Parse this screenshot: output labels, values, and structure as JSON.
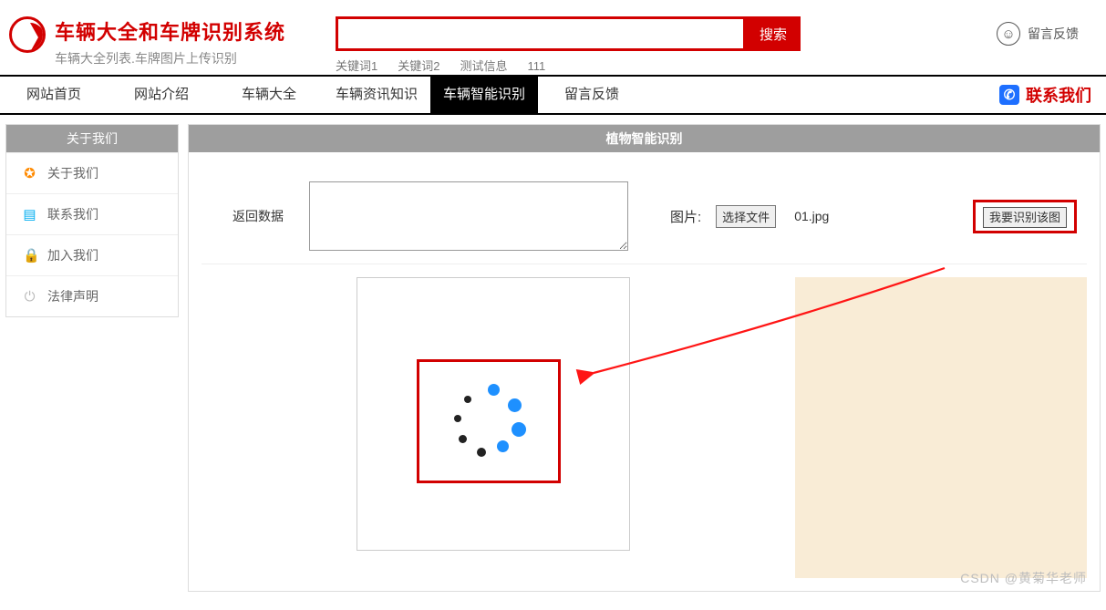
{
  "header": {
    "title": "车辆大全和车牌识别系统",
    "subtitle": "车辆大全列表.车牌图片上传识别",
    "search_button": "搜索",
    "keywords": [
      "关键词1",
      "关键词2",
      "测试信息",
      "111"
    ],
    "feedback_label": "留言反馈"
  },
  "nav": {
    "items": [
      "网站首页",
      "网站介绍",
      "车辆大全",
      "车辆资讯知识",
      "车辆智能识别",
      "留言反馈"
    ],
    "active_index": 4,
    "contact": "联系我们"
  },
  "sidebar": {
    "title": "关于我们",
    "items": [
      {
        "icon": "info-icon",
        "cls": "ic-orange",
        "glyph": "✪",
        "label": "关于我们"
      },
      {
        "icon": "card-icon",
        "cls": "ic-blue",
        "glyph": "▤",
        "label": "联系我们"
      },
      {
        "icon": "lock-icon",
        "cls": "ic-red",
        "glyph": "🔒",
        "label": "加入我们"
      },
      {
        "icon": "power-icon",
        "cls": "ic-gray",
        "glyph": "⏻",
        "label": "法律声明"
      }
    ]
  },
  "main": {
    "title": "植物智能识别",
    "return_label": "返回数据",
    "image_label": "图片:",
    "choose_file": "选择文件",
    "file_name": "01.jpg",
    "recognize": "我要识别该图"
  },
  "watermark": "CSDN @黄菊华老师",
  "colors": {
    "brand": "#d20000",
    "nav_active": "#000000",
    "panel": "#9e9e9e"
  }
}
